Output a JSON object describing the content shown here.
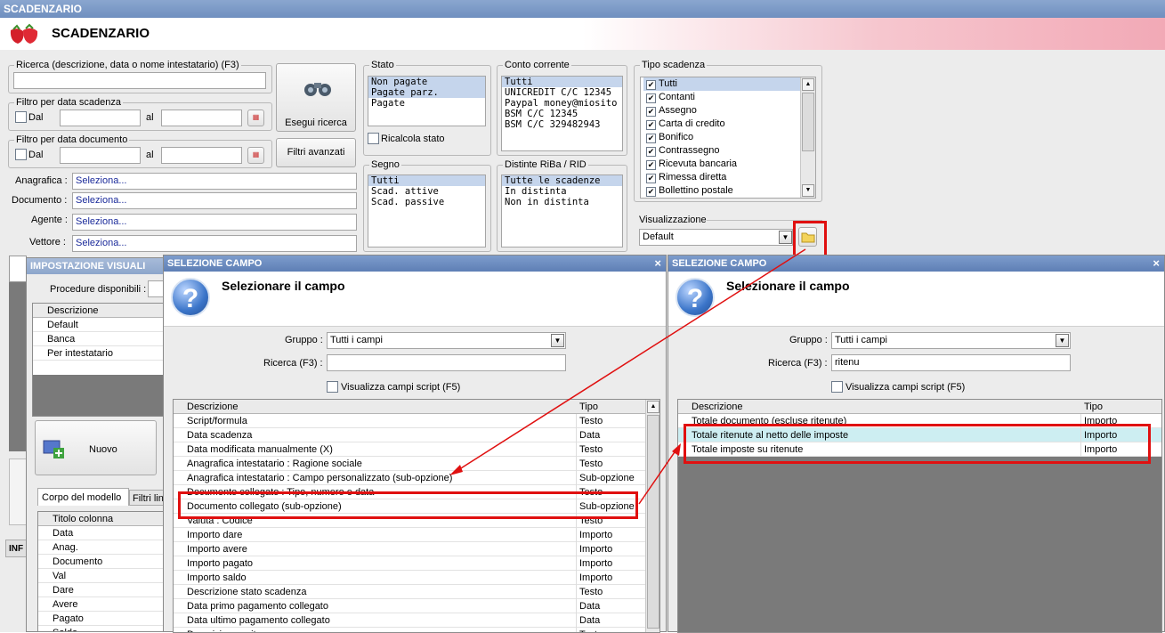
{
  "window": {
    "title": "SCADENZARIO"
  },
  "header": {
    "title": "SCADENZARIO"
  },
  "search": {
    "legend": "Ricerca (descrizione, data o nome intestatario) (F3)",
    "value": "",
    "run_label": "Esegui ricerca",
    "advanced_label": "Filtri avanzati"
  },
  "filter_due": {
    "legend": "Filtro per data scadenza",
    "dal": "Dal",
    "al": "al"
  },
  "filter_doc": {
    "legend": "Filtro per data documento",
    "dal": "Dal",
    "al": "al"
  },
  "lookups": [
    {
      "label": "Anagrafica :",
      "value": "Seleziona..."
    },
    {
      "label": "Documento :",
      "value": "Seleziona..."
    },
    {
      "label": "Agente :",
      "value": "Seleziona..."
    },
    {
      "label": "Vettore :",
      "value": "Seleziona..."
    }
  ],
  "stato": {
    "legend": "Stato",
    "items": [
      "Non pagate",
      "Pagate parz.",
      "Pagate"
    ],
    "recalc": "Ricalcola stato"
  },
  "conto": {
    "legend": "Conto corrente",
    "items": [
      "Tutti",
      "UNICREDIT C/C 12345",
      "Paypal money@miosito",
      "BSM C/C 12345",
      "BSM C/C 329482943"
    ]
  },
  "tipo": {
    "legend": "Tipo scadenza",
    "items": [
      "Tutti",
      "Contanti",
      "Assegno",
      "Carta di credito",
      "Bonifico",
      "Contrassegno",
      "Ricevuta bancaria",
      "Rimessa diretta",
      "Bollettino postale"
    ]
  },
  "segno": {
    "legend": "Segno",
    "items": [
      "Tutti",
      "Scad. attive",
      "Scad. passive"
    ]
  },
  "distinte": {
    "legend": "Distinte RiBa / RID",
    "items": [
      "Tutte le scadenze",
      "In distinta",
      "Non in distinta"
    ]
  },
  "visual": {
    "legend": "Visualizzazione",
    "value": "Default"
  },
  "impostazione": {
    "title": "IMPOSTAZIONE VISUALI",
    "procedure_label": "Procedure disponibili :",
    "col_header": "Descrizione",
    "rows": [
      "Default",
      "Banca",
      "Per intestatario"
    ],
    "new_label": "Nuovo",
    "tabs": [
      "Corpo del modello",
      "Filtri line"
    ],
    "col_title": "Titolo colonna",
    "columns": [
      "Data",
      "Anag.",
      "Documento",
      "Val",
      "Dare",
      "Avere",
      "Pagato",
      "Saldo"
    ],
    "info": "INF"
  },
  "dialog1": {
    "title": "SELEZIONE CAMPO",
    "heading": "Selezionare il campo",
    "group_label": "Gruppo :",
    "group_value": "Tutti i campi",
    "search_label": "Ricerca (F3) :",
    "search_value": "",
    "script_label": "Visualizza campi script (F5)",
    "col_desc": "Descrizione",
    "col_type": "Tipo",
    "rows": [
      {
        "d": "Script/formula",
        "t": "Testo"
      },
      {
        "d": "Data scadenza",
        "t": "Data"
      },
      {
        "d": "Data modificata manualmente (X)",
        "t": "Testo"
      },
      {
        "d": "Anagrafica intestatario : Ragione sociale",
        "t": "Testo"
      },
      {
        "d": "Anagrafica intestatario : Campo personalizzato (sub-opzione)",
        "t": "Sub-opzione"
      },
      {
        "d": "Documento collegato : Tipo, numero e data",
        "t": "Testo"
      },
      {
        "d": "Documento collegato (sub-opzione)",
        "t": "Sub-opzione"
      },
      {
        "d": "Valuta : Codice",
        "t": "Testo"
      },
      {
        "d": "Importo dare",
        "t": "Importo"
      },
      {
        "d": "Importo avere",
        "t": "Importo"
      },
      {
        "d": "Importo pagato",
        "t": "Importo"
      },
      {
        "d": "Importo saldo",
        "t": "Importo"
      },
      {
        "d": "Descrizione stato scadenza",
        "t": "Testo"
      },
      {
        "d": "Data primo pagamento collegato",
        "t": "Data"
      },
      {
        "d": "Data ultimo pagamento collegato",
        "t": "Data"
      },
      {
        "d": "Descrizione esito",
        "t": "Testo"
      }
    ]
  },
  "dialog2": {
    "title": "SELEZIONE CAMPO",
    "heading": "Selezionare il campo",
    "group_label": "Gruppo :",
    "group_value": "Tutti i campi",
    "search_label": "Ricerca (F3) :",
    "search_value": "ritenu",
    "script_label": "Visualizza campi script (F5)",
    "col_desc": "Descrizione",
    "col_type": "Tipo",
    "rows": [
      {
        "d": "Totale documento (escluse ritenute)",
        "t": "Importo"
      },
      {
        "d": "Totale ritenute al netto delle imposte",
        "t": "Importo"
      },
      {
        "d": "Totale imposte su ritenute",
        "t": "Importo"
      }
    ]
  },
  "colors": {
    "accent_red": "#e01010",
    "title_bar": "#6f8fbf",
    "selection": "#c5d5ec"
  }
}
